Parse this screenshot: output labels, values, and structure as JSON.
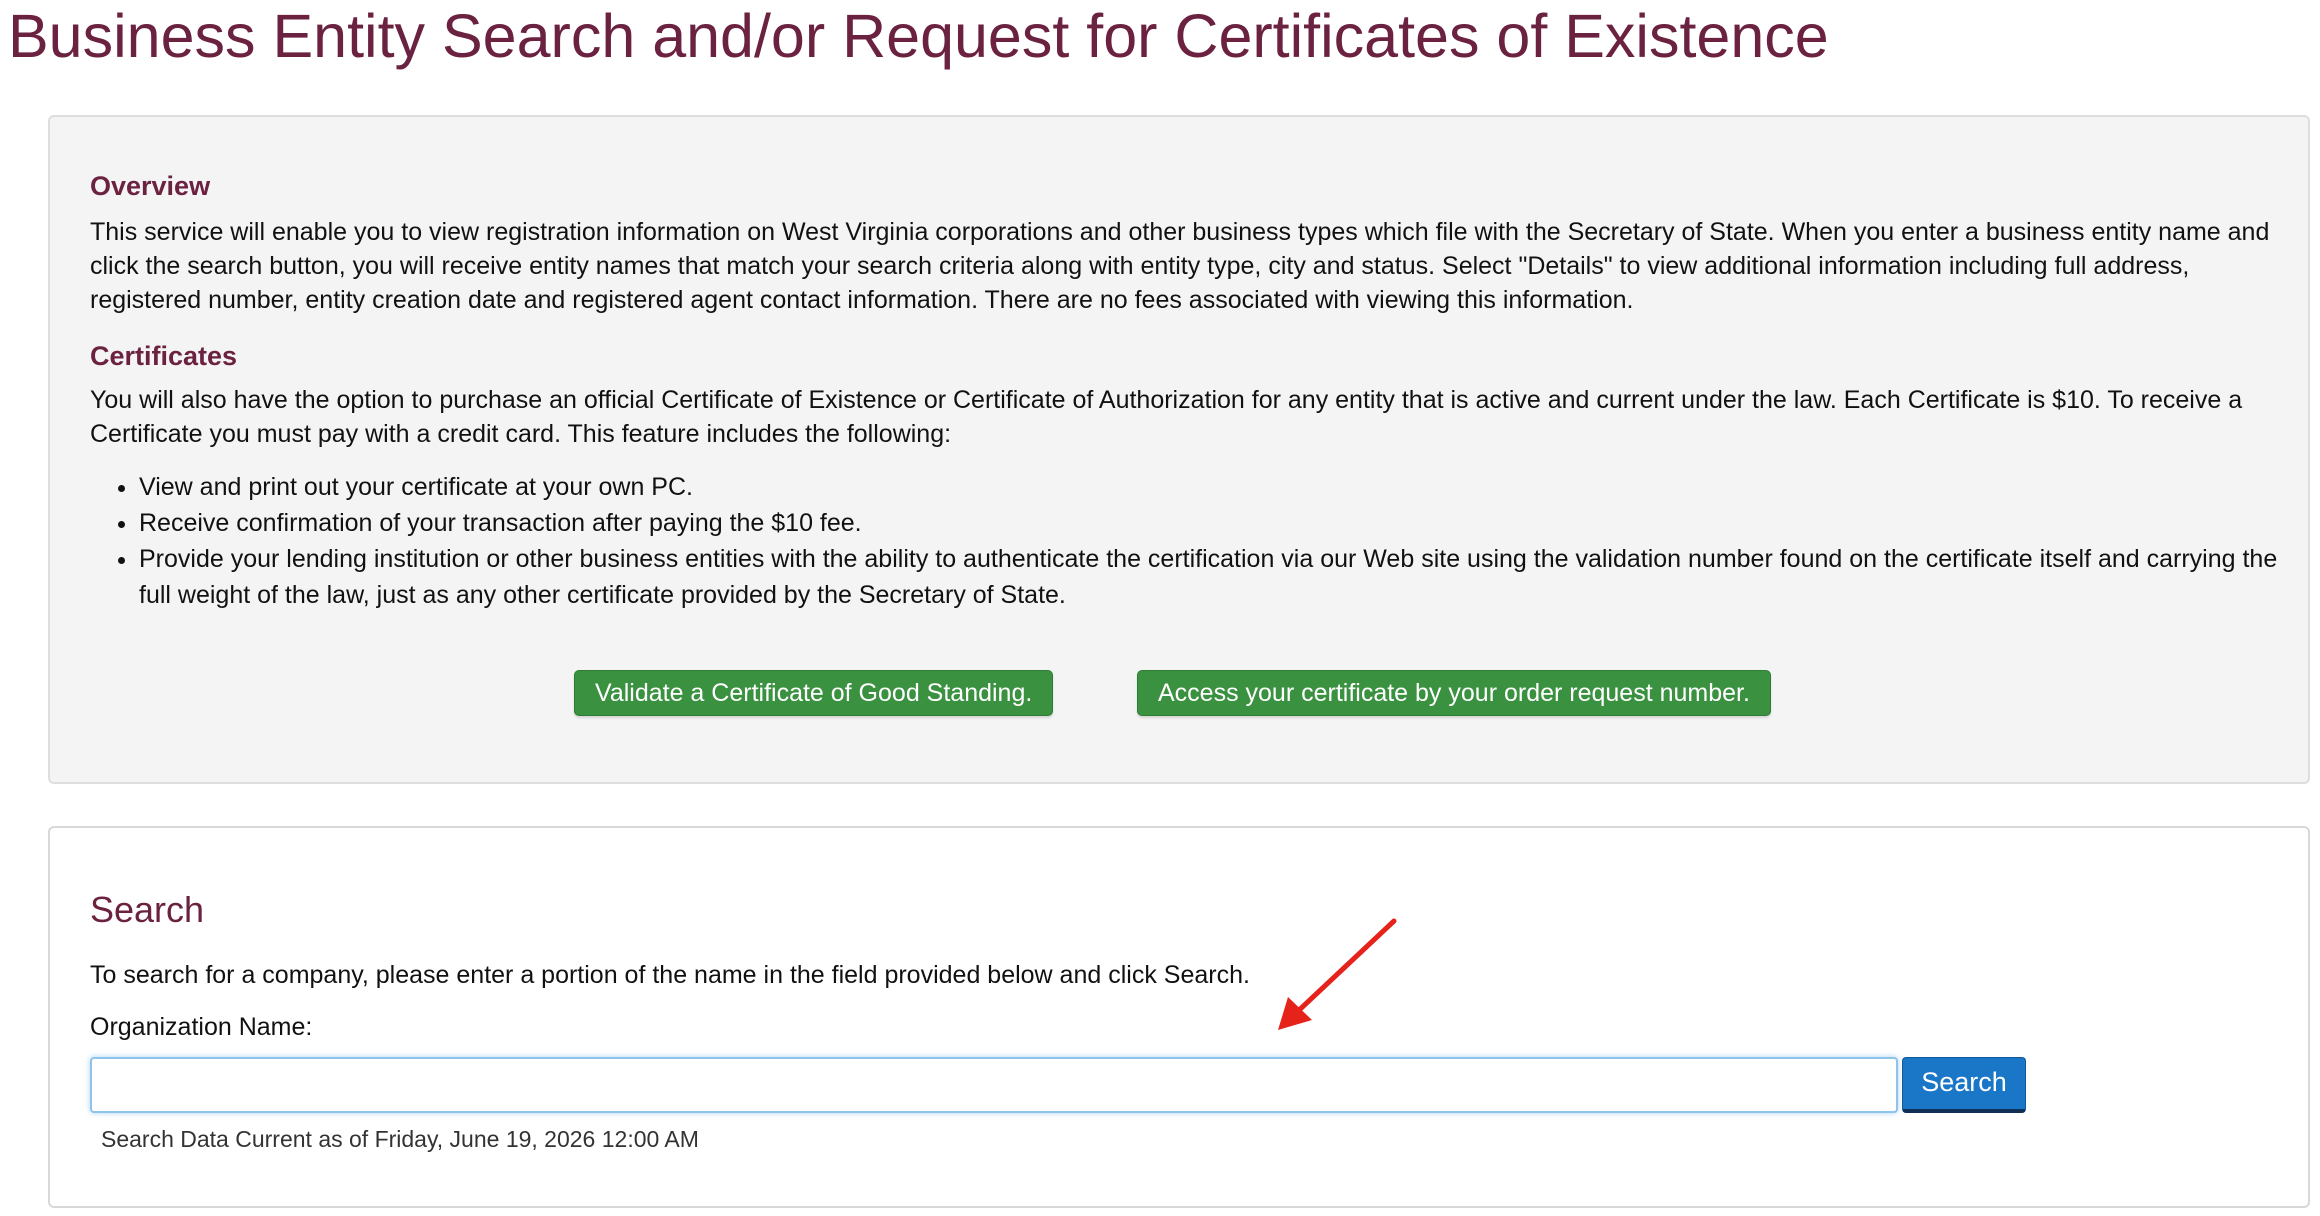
{
  "page": {
    "title": "Business Entity Search and/or Request for Certificates of Existence"
  },
  "overview": {
    "heading": "Overview",
    "text": "This service will enable you to view registration information on West Virginia corporations and other business types which file with the Secretary of State. When you enter a business entity name and click the search button, you will receive entity names that match your search criteria along with entity type, city and status. Select \"Details\" to view additional information including full address, registered number, entity creation date and registered agent contact information. There are no fees associated with viewing this information."
  },
  "certificates": {
    "heading": "Certificates",
    "text": "You will also have the option to purchase an official Certificate of Existence or Certificate of Authorization for any entity that is active and current under the law. Each Certificate is $10. To receive a Certificate you must pay with a credit card. This feature includes the following:",
    "bullets": [
      "View and print out your certificate at your own PC.",
      "Receive confirmation of your transaction after paying the $10 fee.",
      "Provide your lending institution or other business entities with the ability to authenticate the certification via our Web site using the validation number found on the certificate itself and carrying the full weight of the law, just as any other certificate provided by the Secretary of State."
    ]
  },
  "buttons": {
    "validate_label": "Validate a Certificate of Good Standing.",
    "access_label": "Access your certificate by your order request number."
  },
  "search": {
    "heading": "Search",
    "instructions": "To search for a company, please enter a portion of the name in the field provided below and click Search.",
    "field_label": "Organization Name:",
    "input_value": "",
    "button_label": "Search",
    "data_current": "Search Data Current as of Friday, June 19, 2026 12:00 AM"
  },
  "colors": {
    "heading": "#6b2240",
    "green_button": "#3a9140",
    "search_button": "#1a76c6",
    "annotation_arrow": "#e5231b"
  }
}
